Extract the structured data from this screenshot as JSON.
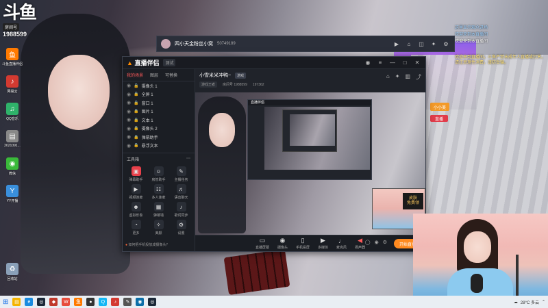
{
  "brand": {
    "logo": "斗鱼",
    "room_label": "房间号",
    "room_id": "1988599"
  },
  "desktop_icons": [
    {
      "label": "斗鱼直播伴侣",
      "icon": "douyu-icon",
      "color": "#ff7a00"
    },
    {
      "label": "网易云",
      "icon": "netease-icon",
      "color": "#d33a31"
    },
    {
      "label": "QQ音乐",
      "icon": "qqmusic-icon",
      "color": "#2fb26a"
    },
    {
      "label": "2021091...",
      "icon": "file-icon",
      "color": "#888888"
    },
    {
      "label": "微信",
      "icon": "wechat-icon",
      "color": "#3aba3a"
    },
    {
      "label": "YY开播",
      "icon": "yy-icon",
      "color": "#3a8fdc"
    },
    {
      "label": "回收站",
      "icon": "recycle-bin-icon",
      "color": "#8aa0b8"
    }
  ],
  "room_bar": {
    "name": "四小天金粉丝小窝",
    "id": "50749189",
    "followers": "50749189"
  },
  "chat": {
    "lines": [
      {
        "nick": "这里显示观众进场",
        "text": ""
      },
      {
        "nick": "欢迎来到本直播间",
        "text": ""
      },
      {
        "nick": "",
        "text": "欢迎来到本直播间"
      }
    ],
    "notice": "欢迎来到直播间，斗鱼严禁未成年人直播或打赏。请注意理性消费，谨防受骗。"
  },
  "side_tags": {
    "orange": "小小美",
    "red": "直播"
  },
  "companion": {
    "logo": "直播伴侣",
    "version": "测试",
    "tabs": [
      "我的场景",
      "图层",
      "可替换"
    ],
    "layers": [
      {
        "name": "摄像头 1"
      },
      {
        "name": "全屏 1"
      },
      {
        "name": "窗口 1"
      },
      {
        "name": "图片 1"
      },
      {
        "name": "文本 1"
      },
      {
        "name": "摄像头 2"
      },
      {
        "name": "弹幕助手"
      },
      {
        "name": "悬浮文本"
      }
    ],
    "tools_label": "工具箱",
    "tools": [
      {
        "label": "弹幕助手",
        "icon": "danmaku-icon",
        "hot": true
      },
      {
        "label": "房管助手",
        "icon": "manager-icon",
        "hot": false
      },
      {
        "label": "主播任务",
        "icon": "task-icon",
        "hot": false
      },
      {
        "label": "视频连麦",
        "icon": "video-link-icon",
        "hot": false
      },
      {
        "label": "多人连麦",
        "icon": "multi-link-icon",
        "hot": false
      },
      {
        "label": "语音聊天",
        "icon": "voice-icon",
        "hot": false
      },
      {
        "label": "虚拟形象",
        "icon": "avatar-icon",
        "hot": false
      },
      {
        "label": "弹幕墙",
        "icon": "wall-icon",
        "hot": false
      },
      {
        "label": "歌词同步",
        "icon": "lyrics-icon",
        "hot": false
      },
      {
        "label": "更多",
        "icon": "more-icon",
        "hot": false
      },
      {
        "label": "美颜",
        "icon": "beauty-icon",
        "hot": false
      },
      {
        "label": "设置",
        "icon": "settings-icon",
        "hot": false
      }
    ],
    "tip": "如何把手机投放成摄像头？",
    "room_title": "小雪米米冲鸭~",
    "room_tag": "游戏",
    "room_sub": "游戏王者",
    "room_meta": "房间号 1988599",
    "room_fans": "197362",
    "controls": [
      {
        "label": "直播屏幕",
        "icon": "screen-icon"
      },
      {
        "label": "摄像头",
        "icon": "camera-icon"
      },
      {
        "label": "手机投屏",
        "icon": "phone-icon"
      },
      {
        "label": "多媒体",
        "icon": "media-icon"
      },
      {
        "label": "麦克风",
        "icon": "mic-icon"
      },
      {
        "label": "扬声器",
        "icon": "speaker-icon"
      }
    ],
    "start_label": "开始直播",
    "pip_badge": "皮肤\n免费领"
  },
  "taskbar": {
    "apps": [
      {
        "icon": "explorer-icon",
        "color": "#f4b400"
      },
      {
        "icon": "edge-icon",
        "color": "#1a8ce0"
      },
      {
        "icon": "steam-icon",
        "color": "#1b2838"
      },
      {
        "icon": "game-icon",
        "color": "#c0392b"
      },
      {
        "icon": "wegame-icon",
        "color": "#e74c3c"
      },
      {
        "icon": "douyu-app-icon",
        "color": "#ff7a00"
      },
      {
        "icon": "obs-icon",
        "color": "#333333"
      },
      {
        "icon": "qq-icon",
        "color": "#12b7f5"
      },
      {
        "icon": "music-icon",
        "color": "#d33a31"
      },
      {
        "icon": "tool-icon",
        "color": "#555555"
      },
      {
        "icon": "camera-app-icon",
        "color": "#0b6ea8"
      },
      {
        "icon": "steam2-icon",
        "color": "#1b2838"
      }
    ],
    "weather": "28°C 多云",
    "time": ""
  }
}
